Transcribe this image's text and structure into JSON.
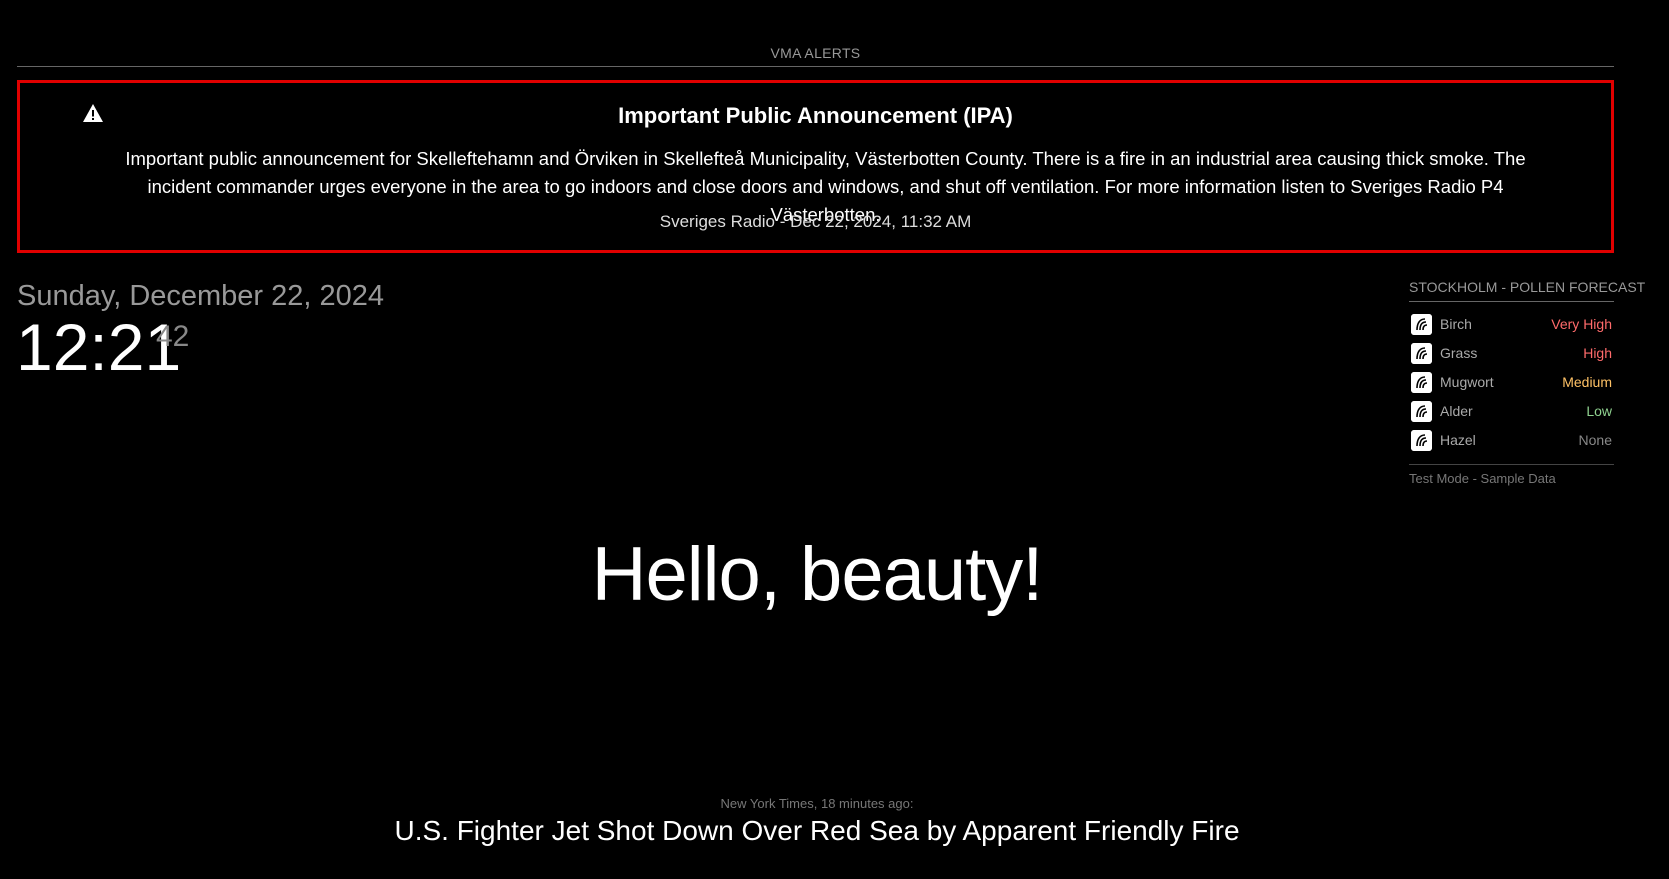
{
  "vma": {
    "header": "VMA ALERTS",
    "alert": {
      "icon": "warning-icon",
      "title": "Important Public Announcement (IPA)",
      "body": "Important public announcement for Skelleftehamn and Örviken in Skellefteå Municipality, Västerbotten County. There is a fire in an industrial area causing thick smoke. The incident commander urges everyone in the area to go indoors and close doors and windows, and shut off ventilation. For more information listen to Sveriges Radio P4 Västerbotten.",
      "source": "Sveriges Radio - Dec 22, 2024, 11:32 AM",
      "border_color": "#e00000"
    }
  },
  "clock": {
    "date": "Sunday, December 22, 2024",
    "time": "12:21",
    "seconds": "42"
  },
  "pollen": {
    "header": "STOCKHOLM - POLLEN FORECAST",
    "items": [
      {
        "icon": "pollen-icon",
        "name": "Birch",
        "level": "Very High",
        "color": "#ff6b6b"
      },
      {
        "icon": "pollen-icon",
        "name": "Grass",
        "level": "High",
        "color": "#ff6b6b"
      },
      {
        "icon": "pollen-icon",
        "name": "Mugwort",
        "level": "Medium",
        "color": "#ffc266"
      },
      {
        "icon": "pollen-icon",
        "name": "Alder",
        "level": "Low",
        "color": "#8fd18f"
      },
      {
        "icon": "pollen-icon",
        "name": "Hazel",
        "level": "None",
        "color": "#888888"
      }
    ],
    "footer": "Test Mode - Sample Data"
  },
  "compliment": {
    "text": "Hello, beauty!"
  },
  "news": {
    "source": "New York Times, 18 minutes ago:",
    "headline": "U.S. Fighter Jet Shot Down Over Red Sea by Apparent Friendly Fire"
  }
}
